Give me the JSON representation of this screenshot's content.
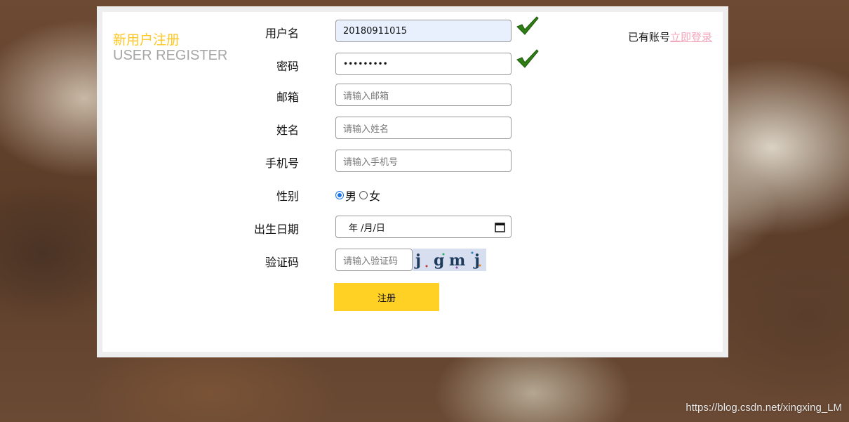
{
  "header": {
    "title_cn": "新用户注册",
    "title_en": "USER REGISTER",
    "has_account_text": "已有账号",
    "login_link": "立即登录"
  },
  "form": {
    "username": {
      "label": "用户名",
      "value": "20180911015",
      "valid": true
    },
    "password": {
      "label": "密码",
      "value": "•••••••••",
      "valid": true
    },
    "email": {
      "label": "邮箱",
      "placeholder": "请输入邮箱"
    },
    "name": {
      "label": "姓名",
      "placeholder": "请输入姓名"
    },
    "phone": {
      "label": "手机号",
      "placeholder": "请输入手机号"
    },
    "gender": {
      "label": "性别",
      "options": [
        "男",
        "女"
      ],
      "selected": "男"
    },
    "birthday": {
      "label": "出生日期",
      "value": "年 /月/日"
    },
    "captcha": {
      "label": "验证码",
      "placeholder": "请输入验证码",
      "image_text": "jgmj"
    },
    "submit_label": "注册"
  },
  "colors": {
    "accent_yellow": "#ffc726",
    "title_gray": "#a6a6a6",
    "link_pink": "#f3a7bd",
    "submit_bg": "#ffd125",
    "check_green": "#2e7d15"
  },
  "watermark": "https://blog.csdn.net/xingxing_LM"
}
